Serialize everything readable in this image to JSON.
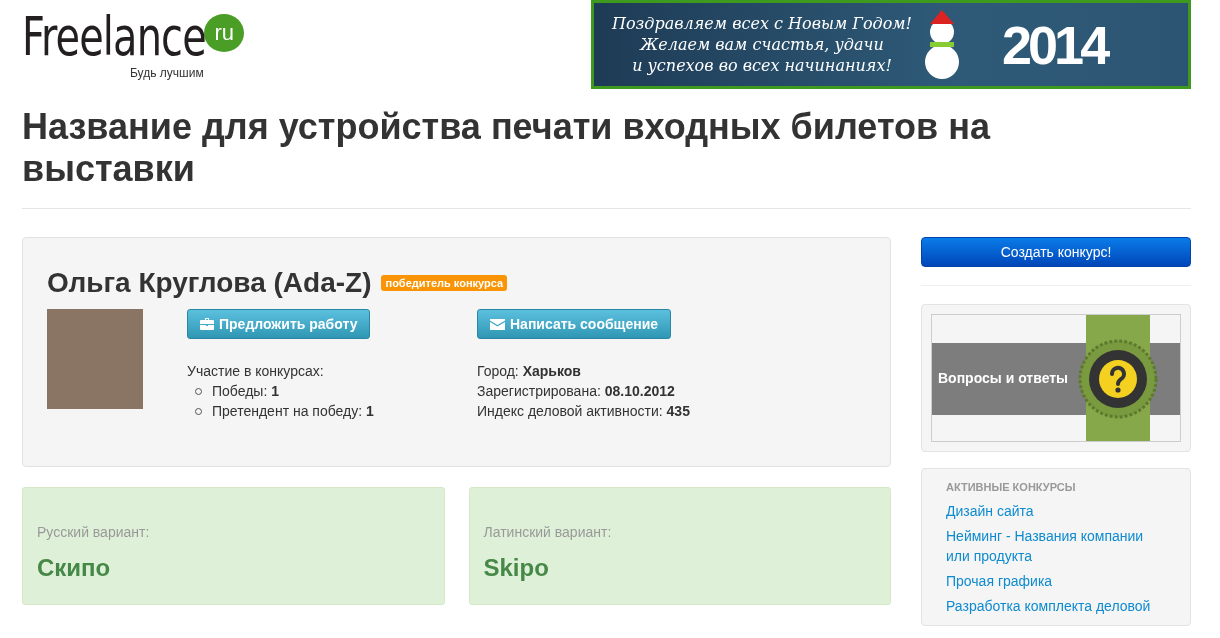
{
  "header": {
    "logo": {
      "text": "Freelance",
      "badge": "ru",
      "tagline": "Будь лучшим"
    },
    "banner": {
      "lines": [
        "Поздравляем всех с Новым Годом!",
        "Желаем вам счастья, удачи",
        "и успехов во всех начинаниях!"
      ],
      "year": "2014"
    }
  },
  "title": "Название для устройства печати входных билетов на выставки",
  "profile": {
    "name": "Ольга Круглова (Ada-Z)",
    "badge": "победитель конкурса",
    "buttons": [
      {
        "label": "Предложить работу",
        "kind": "offer"
      },
      {
        "label": "Написать сообщение",
        "kind": "message"
      }
    ],
    "contests": {
      "heading": "Участие в конкурсах:",
      "items": [
        "Победы: **1**",
        "Претендент на победу: **1**"
      ]
    },
    "details": [
      "Город: **Харьков**",
      "Зарегистрирована: **08.10.2012**",
      "Индекс деловой активности: **435**"
    ]
  },
  "variants": [
    {
      "label": "Русский вариант:",
      "value": "Скипо"
    },
    {
      "label": "Латинский вариант:",
      "value": "Skipo"
    }
  ],
  "sidebar": {
    "create_button": "Создать конкурс!",
    "faq_banner": "Вопросы и ответы",
    "active_contests": {
      "heading": "АКТИВНЫЕ КОНКУРСЫ",
      "items": [
        "Дизайн сайта",
        "Нейминг - Названия компании или продукта",
        "Прочая графика",
        "Разработка комплекта деловой"
      ]
    }
  }
}
